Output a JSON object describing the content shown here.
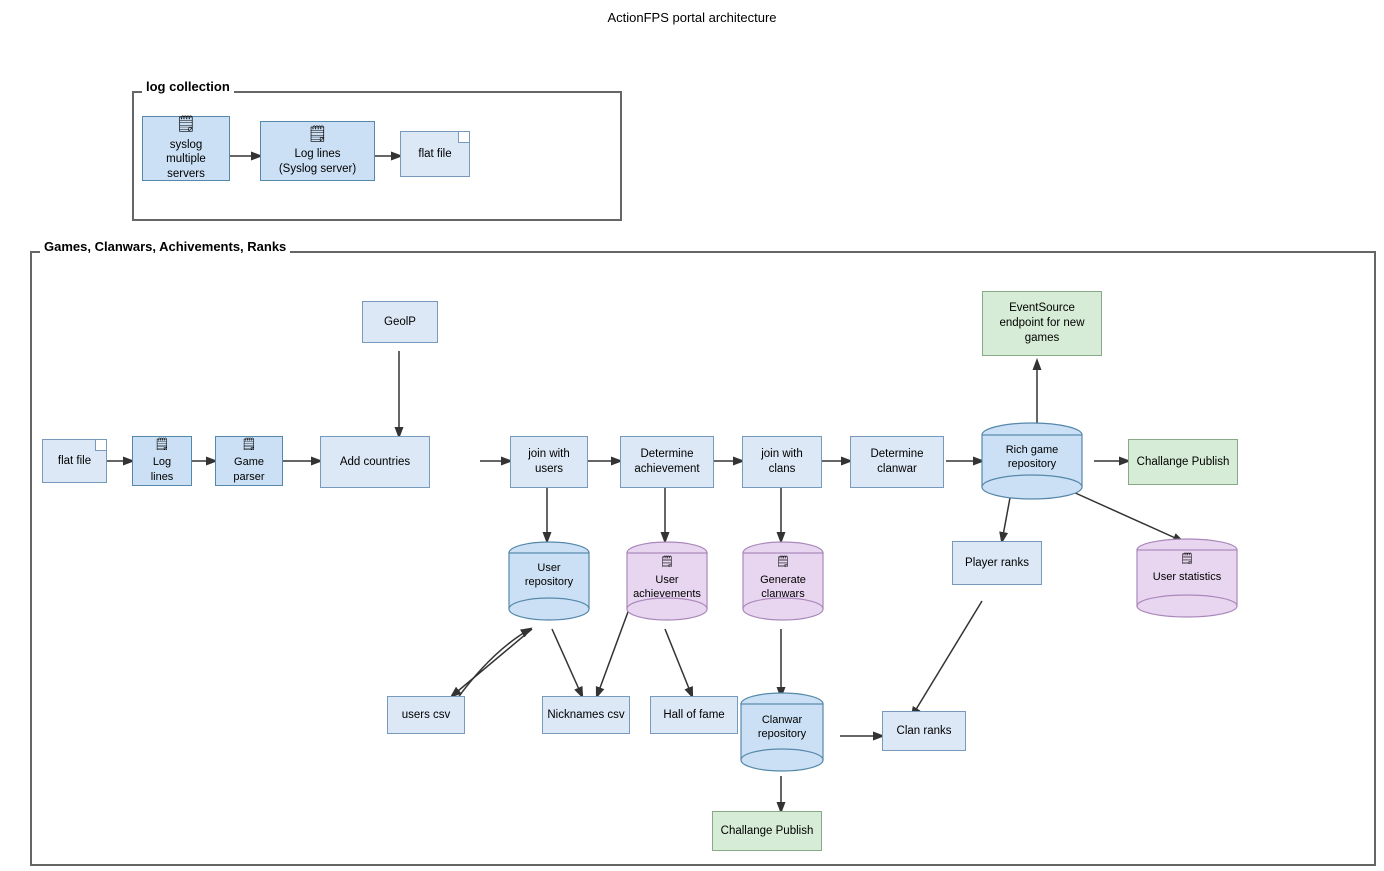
{
  "title": "ActionFPS portal architecture",
  "groups": {
    "log_collection": "log collection",
    "main": "Games, Clanwars, Achivements, Ranks"
  },
  "nodes": {
    "syslog": "syslog\nmultiple servers",
    "log_lines_top": "Log lines\n(Syslog server)",
    "flat_file_top": "flat file",
    "flat_file_main": "flat file",
    "log_lines_main": "Log\nlines",
    "game_parser": "Game\nparser",
    "geoip": "GeolP",
    "add_countries": "Add countries",
    "join_users": "join with\nusers",
    "determine_achievement": "Determine\nachievement",
    "join_clans": "join with\nclans",
    "determine_clanwar": "Determine\nclanwar",
    "rich_game_repo": "Rich game\nrepository",
    "challange_publish_top": "Challange Publish",
    "eventsource": "EventSource\nendpoint for new\ngames",
    "user_repo": "User\nrepository",
    "user_achievements": "User\nachievements",
    "generate_clanwars": "Generate\nclanwars",
    "player_ranks": "Player ranks",
    "user_statistics": "User statistics",
    "users_csv": "users csv",
    "nicknames_csv": "Nicknames csv",
    "hall_of_fame": "Hall of fame",
    "clanwar_repo": "Clanwar\nrepository",
    "clan_ranks": "Clan ranks",
    "challange_publish_bottom": "Challange Publish"
  }
}
